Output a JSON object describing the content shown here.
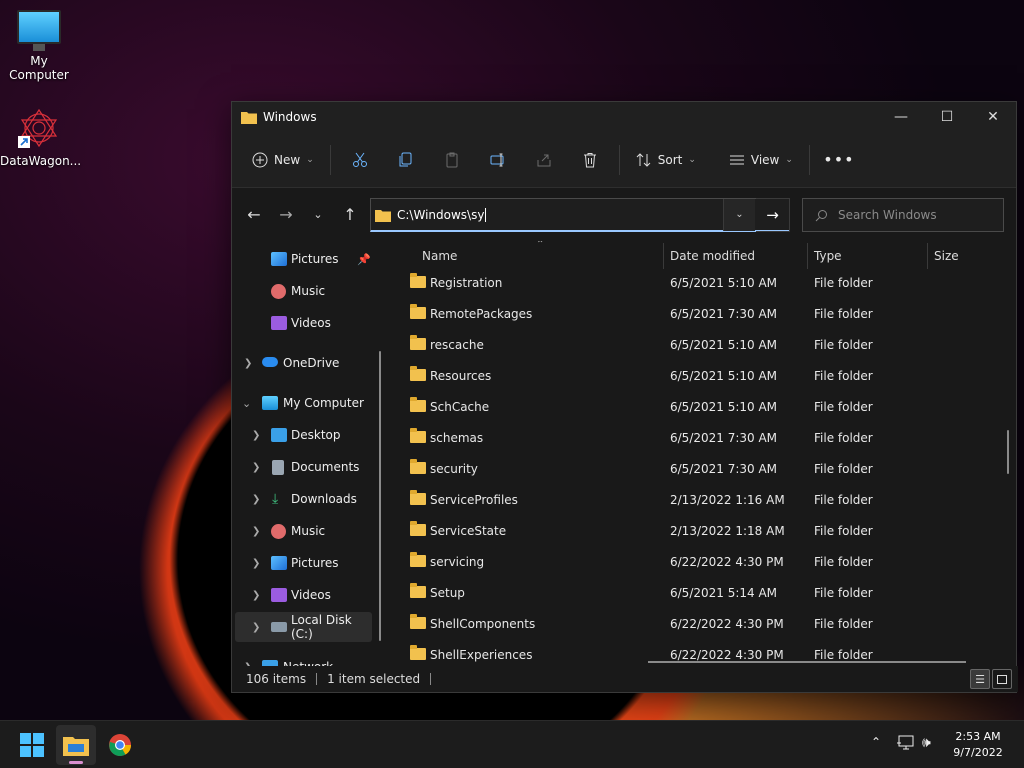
{
  "desktop": {
    "icons": [
      {
        "label": "My Computer",
        "icon": "monitor-icon"
      },
      {
        "label": "DataWagon...",
        "icon": "datawagon-shortcut-icon"
      }
    ]
  },
  "window": {
    "title": "Windows",
    "toolbar": {
      "new_label": "New",
      "sort_label": "Sort",
      "view_label": "View"
    },
    "address": {
      "value": "C:\\Windows\\sy"
    },
    "search": {
      "placeholder": "Search Windows"
    },
    "nav_pane": {
      "items": [
        {
          "label": "Pictures",
          "icon": "pictures-icon",
          "pinned": true
        },
        {
          "label": "Music",
          "icon": "music-icon"
        },
        {
          "label": "Videos",
          "icon": "videos-icon"
        },
        {
          "label": "OneDrive",
          "icon": "onedrive-icon"
        },
        {
          "label": "My Computer",
          "icon": "computer-icon"
        },
        {
          "label": "Desktop",
          "icon": "desktop-icon"
        },
        {
          "label": "Documents",
          "icon": "documents-icon"
        },
        {
          "label": "Downloads",
          "icon": "downloads-icon"
        },
        {
          "label": "Music",
          "icon": "music-icon"
        },
        {
          "label": "Pictures",
          "icon": "pictures-icon"
        },
        {
          "label": "Videos",
          "icon": "videos-icon"
        },
        {
          "label": "Local Disk (C:)",
          "icon": "drive-icon",
          "selected": true
        },
        {
          "label": "Network",
          "icon": "network-icon"
        }
      ]
    },
    "columns": {
      "name": "Name",
      "date": "Date modified",
      "type": "Type",
      "size": "Size"
    },
    "files": [
      {
        "name": "Registration",
        "date": "6/5/2021 5:10 AM",
        "type": "File folder"
      },
      {
        "name": "RemotePackages",
        "date": "6/5/2021 7:30 AM",
        "type": "File folder"
      },
      {
        "name": "rescache",
        "date": "6/5/2021 5:10 AM",
        "type": "File folder"
      },
      {
        "name": "Resources",
        "date": "6/5/2021 5:10 AM",
        "type": "File folder"
      },
      {
        "name": "SchCache",
        "date": "6/5/2021 5:10 AM",
        "type": "File folder"
      },
      {
        "name": "schemas",
        "date": "6/5/2021 7:30 AM",
        "type": "File folder"
      },
      {
        "name": "security",
        "date": "6/5/2021 7:30 AM",
        "type": "File folder"
      },
      {
        "name": "ServiceProfiles",
        "date": "2/13/2022 1:16 AM",
        "type": "File folder"
      },
      {
        "name": "ServiceState",
        "date": "2/13/2022 1:18 AM",
        "type": "File folder"
      },
      {
        "name": "servicing",
        "date": "6/22/2022 4:30 PM",
        "type": "File folder"
      },
      {
        "name": "Setup",
        "date": "6/5/2021 5:14 AM",
        "type": "File folder"
      },
      {
        "name": "ShellComponents",
        "date": "6/22/2022 4:30 PM",
        "type": "File folder"
      },
      {
        "name": "ShellExperiences",
        "date": "6/22/2022 4:30 PM",
        "type": "File folder"
      }
    ],
    "status": {
      "items": "106 items",
      "selected": "1 item selected"
    }
  },
  "taskbar": {
    "clock_time": "2:53 AM",
    "clock_date": "9/7/2022"
  }
}
